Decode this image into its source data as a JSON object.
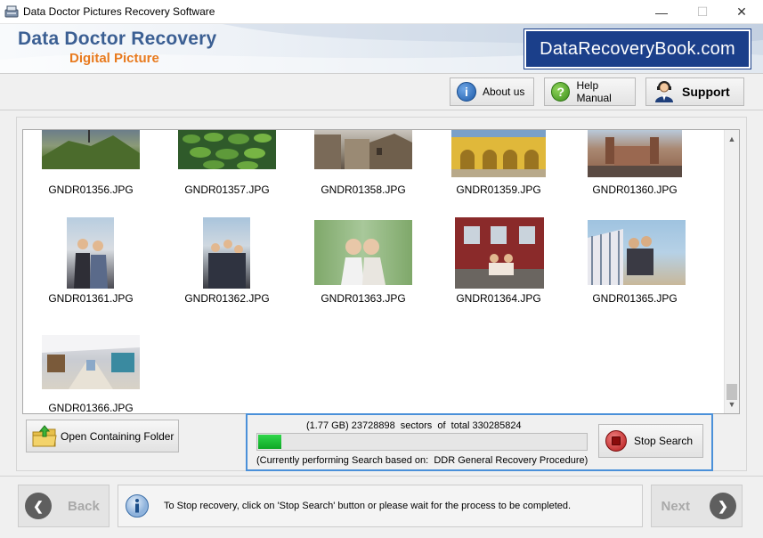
{
  "window": {
    "title": "Data Doctor Pictures Recovery Software",
    "minimize_glyph": "—",
    "maximize_glyph": "☐",
    "close_glyph": "✕"
  },
  "header": {
    "brand_title": "Data Doctor Recovery",
    "brand_subtitle": "Digital Picture",
    "site_badge": "DataRecoveryBook.com"
  },
  "toolbar": {
    "about_label": "About us",
    "help_label": "Help Manual",
    "support_label": "Support"
  },
  "gallery": {
    "items": [
      {
        "filename": "GNDR01356.JPG"
      },
      {
        "filename": "GNDR01357.JPG"
      },
      {
        "filename": "GNDR01358.JPG"
      },
      {
        "filename": "GNDR01359.JPG"
      },
      {
        "filename": "GNDR01360.JPG"
      },
      {
        "filename": "GNDR01361.JPG"
      },
      {
        "filename": "GNDR01362.JPG"
      },
      {
        "filename": "GNDR01363.JPG"
      },
      {
        "filename": "GNDR01364.JPG"
      },
      {
        "filename": "GNDR01365.JPG"
      },
      {
        "filename": "GNDR01366.JPG"
      }
    ],
    "scroll_up_glyph": "▲",
    "scroll_down_glyph": "▼"
  },
  "actions": {
    "open_folder_label": "Open Containing Folder",
    "stop_search_label": "Stop Search"
  },
  "progress": {
    "sector_text": "(1.77 GB) 23728898  sectors  of  total 330285824",
    "process_text": "(Currently performing Search based on:  DDR General Recovery Procedure)",
    "fraction": 0.0718
  },
  "footer": {
    "back_label": "Back",
    "next_label": "Next",
    "info_text": "To Stop recovery, click on 'Stop Search' button or please wait for the process to be completed.",
    "back_glyph": "❮",
    "next_glyph": "❯"
  },
  "colors": {
    "brand_blue": "#3b5f93",
    "brand_orange": "#e87a1e",
    "badge_blue": "#1b3f8a",
    "progress_green": "#17b833",
    "panel_highlight": "#4a90d9"
  }
}
